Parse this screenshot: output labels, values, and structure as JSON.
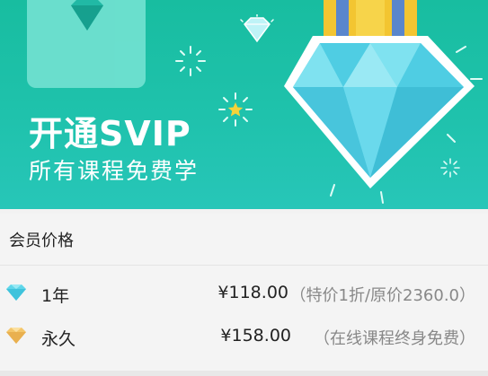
{
  "banner": {
    "title": "开通SVIP",
    "subtitle": "所有课程免费学"
  },
  "section": {
    "title": "会员价格"
  },
  "plans": [
    {
      "icon": "blue-diamond-icon",
      "label": "1年",
      "price": "¥118.00",
      "note": "（特价1折/原价2360.0）"
    },
    {
      "icon": "gold-diamond-icon",
      "label": "永久",
      "price": "¥158.00",
      "note": "（在线课程终身免费）"
    }
  ],
  "colors": {
    "banner_bg": "#1fc2ac",
    "diamond_blue": "#5fd6ea",
    "diamond_gold": "#f4c66a",
    "ribbon_yellow": "#f3c531",
    "ribbon_blue": "#5a86cc"
  }
}
